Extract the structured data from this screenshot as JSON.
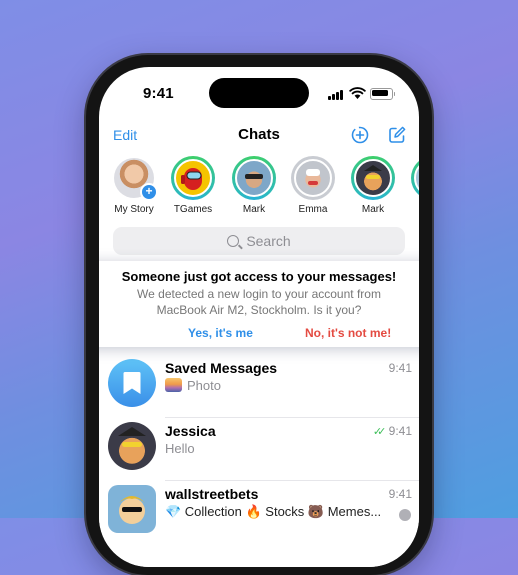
{
  "status": {
    "time": "9:41"
  },
  "header": {
    "edit_label": "Edit",
    "title": "Chats"
  },
  "stories": [
    {
      "label": "My Story",
      "state": "own"
    },
    {
      "label": "TGames",
      "state": "active"
    },
    {
      "label": "Mark",
      "state": "active"
    },
    {
      "label": "Emma",
      "state": "seen"
    },
    {
      "label": "Mark",
      "state": "active"
    }
  ],
  "search": {
    "placeholder": "Search"
  },
  "alert": {
    "title": "Someone just got access to your messages!",
    "text": "We detected a new login to your account from MacBook Air M2, Stockholm. Is it you?",
    "yes_label": "Yes, it's me",
    "no_label": "No, it's not me!"
  },
  "chats": [
    {
      "name": "Saved Messages",
      "preview": "Photo",
      "time": "9:41"
    },
    {
      "name": "Jessica",
      "preview": "Hello",
      "time": "9:41"
    },
    {
      "name": "wallstreetbets",
      "preview": "💎 Collection 🔥 Stocks 🐻 Memes...",
      "time": "9:41"
    }
  ],
  "colors": {
    "accent": "#2f8fe8",
    "danger": "#e44b42",
    "read": "#3ebf5a"
  }
}
